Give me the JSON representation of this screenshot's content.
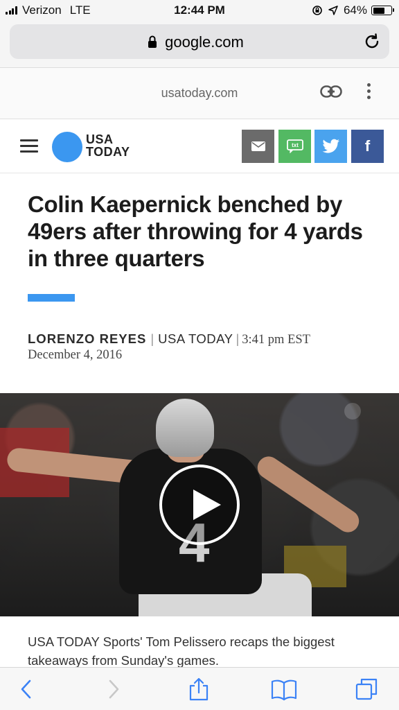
{
  "status_bar": {
    "carrier": "Verizon",
    "network": "LTE",
    "time": "12:44 PM",
    "battery": "64%",
    "battery_level": 0.64
  },
  "browser": {
    "url": "google.com",
    "amp_domain": "usatoday.com"
  },
  "site": {
    "logo_line1": "USA",
    "logo_line2": "TODAY",
    "share_facebook": "f",
    "share_sms": "txt"
  },
  "article": {
    "headline": "Colin Kaepernick benched by 49ers after throwing for 4 yards in three quarters",
    "author": "LORENZO REYES",
    "organization": "USA TODAY",
    "time": "3:41 pm EST",
    "date": "December 4, 2016",
    "jersey_number": "4",
    "caption": "USA TODAY Sports' Tom Pelissero recaps the biggest takeaways from Sunday's games."
  },
  "colors": {
    "accent": "#3b97f0",
    "email": "#6b6b6b",
    "sms": "#53b963",
    "twitter": "#4aa3ee",
    "facebook": "#3b5998"
  }
}
